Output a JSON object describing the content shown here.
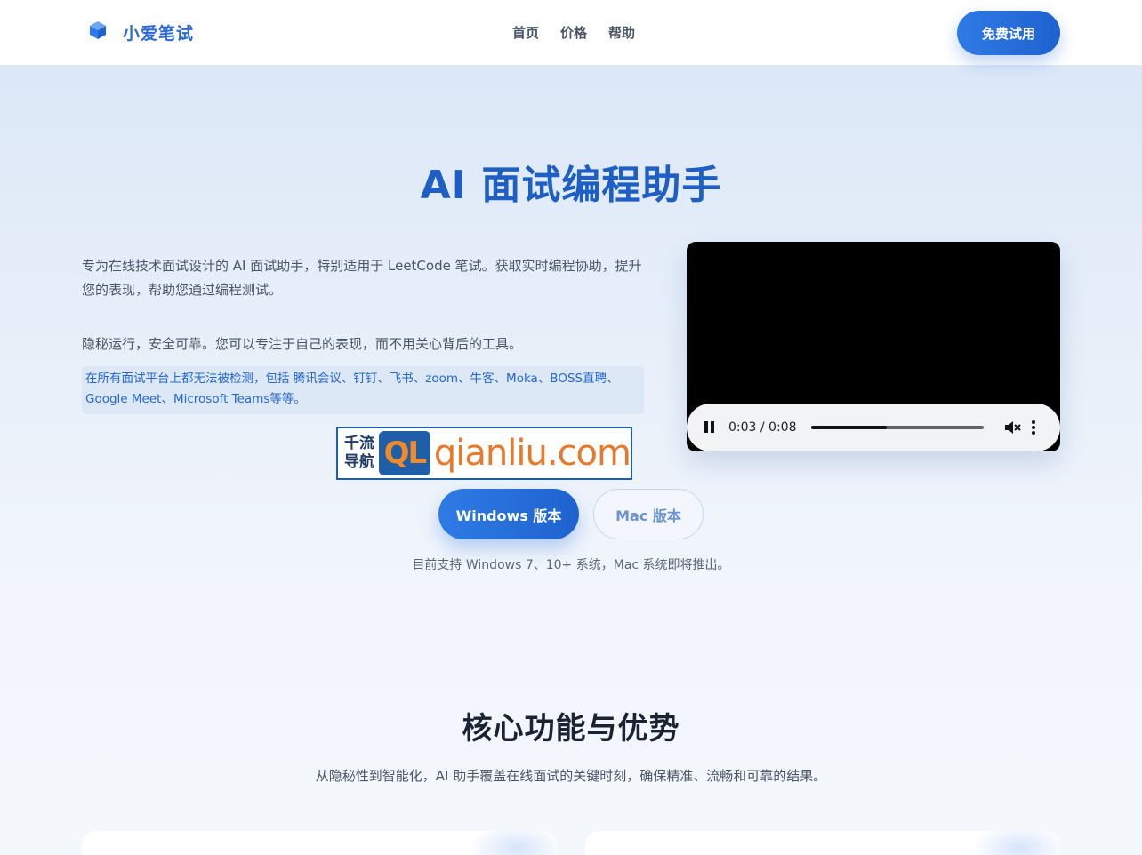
{
  "header": {
    "brand": "小爱笔试",
    "nav": [
      "首页",
      "价格",
      "帮助"
    ],
    "cta": "免费试用"
  },
  "hero": {
    "title": "AI 面试编程助手",
    "description": "专为在线技术面试设计的 AI 面试助手，特别适用于 LeetCode 笔试。获取实时编程协助，提升您的表现，帮助您通过编程测试。",
    "description2": "隐秘运行，安全可靠。您可以专注于自己的表现，而不用关心背后的工具。",
    "note": "在所有面试平台上都无法被检测，包括 腾讯会议、钉钉、飞书、zoom、牛客、Moka、BOSS直聘、Google Meet、Microsoft Teams等等。",
    "windows_button": "Windows 版本",
    "mac_button": "Mac 版本",
    "support_text": "目前支持 Windows 7、10+ 系统，Mac 系统即将推出。"
  },
  "watermark": {
    "cn_line1": "千流",
    "cn_line2": "导航",
    "mark": "QL",
    "domain": "qianliu.com"
  },
  "video": {
    "current_time": "0:03",
    "duration": "0:08",
    "time_display": "0:03 / 0:08",
    "progress": 0.44,
    "muted": true,
    "playing": true
  },
  "features": {
    "title": "核心功能与优势",
    "subtitle": "从隐秘性到智能化，AI 助手覆盖在线面试的关键时刻，确保精准、流畅和可靠的结果。"
  },
  "colors": {
    "accent": "#1f62cf",
    "brand": "#2b6ad6",
    "title": "#1d5fc4"
  }
}
